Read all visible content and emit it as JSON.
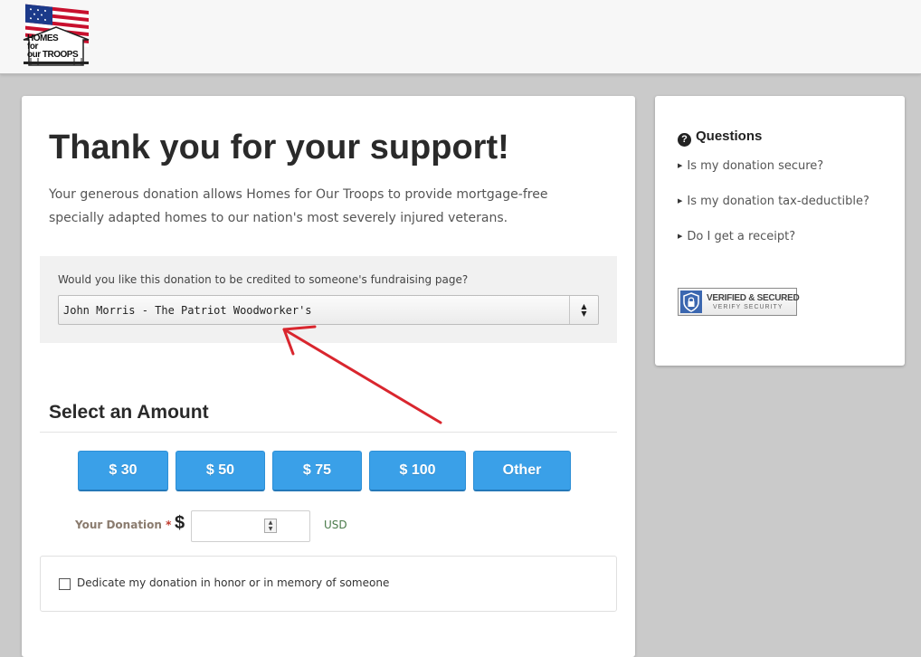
{
  "header": {
    "logo": {
      "line1": "HOMES",
      "line2": "for",
      "line3": "our TROOPS"
    }
  },
  "main": {
    "title": "Thank you for your support!",
    "intro": "Your generous donation allows Homes for Our Troops to provide mortgage-free specially adapted homes to our nation's most severely injured veterans.",
    "credit": {
      "label": "Would you like this donation to be credited to someone's fundraising page?",
      "selected": "John Morris - The Patriot Woodworker's"
    },
    "amount_heading": "Select an Amount",
    "amount_buttons": [
      "$ 30",
      "$ 50",
      "$ 75",
      "$ 100",
      "Other"
    ],
    "donation": {
      "label": "Your Donation",
      "required_mark": "*",
      "currency_symbol": "$",
      "value": "",
      "currency": "USD"
    },
    "dedicate_label": "Dedicate my donation in honor or in memory of someone"
  },
  "sidebar": {
    "questions_title": "Questions",
    "questions": [
      "Is my donation secure?",
      "Is my donation tax-deductible?",
      "Do I get a receipt?"
    ],
    "badge": {
      "line1": "VERIFIED & SECURED",
      "line2": "VERIFY SECURITY"
    }
  },
  "colors": {
    "button_blue": "#3aa0e8",
    "annotation_arrow": "#d9262e",
    "background": "#cacaca"
  }
}
